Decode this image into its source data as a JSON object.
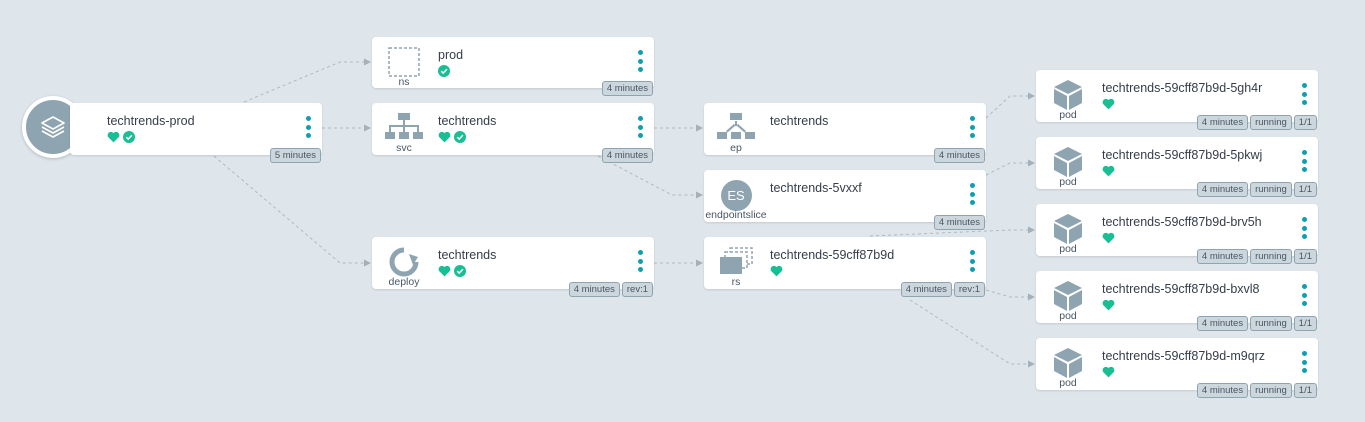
{
  "colors": {
    "background": "#dee6eb",
    "healthy": "#18be94",
    "accent": "#0f9fb0",
    "icon": "#8fa4b1",
    "edge": "#b0b9bf"
  },
  "app": {
    "title": "techtrends-prod",
    "age": "5 minutes",
    "icon": "layers-icon"
  },
  "nodes": {
    "ns": {
      "title": "prod",
      "kind": "ns",
      "age": "4 minutes"
    },
    "svc": {
      "title": "techtrends",
      "kind": "svc",
      "age": "4 minutes"
    },
    "deploy": {
      "title": "techtrends",
      "kind": "deploy",
      "age": "4 minutes",
      "rev": "rev:1"
    },
    "ep": {
      "title": "techtrends",
      "kind": "ep",
      "age": "4 minutes"
    },
    "es": {
      "title": "techtrends-5vxxf",
      "kind": "endpointslice",
      "icon_text": "ES",
      "age": "4 minutes"
    },
    "rs": {
      "title": "techtrends-59cff87b9d",
      "kind": "rs",
      "age": "4 minutes",
      "rev": "rev:1"
    }
  },
  "pods": [
    {
      "title": "techtrends-59cff87b9d-5gh4r",
      "kind": "pod",
      "age": "4 minutes",
      "status": "running",
      "ready": "1/1"
    },
    {
      "title": "techtrends-59cff87b9d-5pkwj",
      "kind": "pod",
      "age": "4 minutes",
      "status": "running",
      "ready": "1/1"
    },
    {
      "title": "techtrends-59cff87b9d-brv5h",
      "kind": "pod",
      "age": "4 minutes",
      "status": "running",
      "ready": "1/1"
    },
    {
      "title": "techtrends-59cff87b9d-bxvl8",
      "kind": "pod",
      "age": "4 minutes",
      "status": "running",
      "ready": "1/1"
    },
    {
      "title": "techtrends-59cff87b9d-m9qrz",
      "kind": "pod",
      "age": "4 minutes",
      "status": "running",
      "ready": "1/1"
    }
  ]
}
